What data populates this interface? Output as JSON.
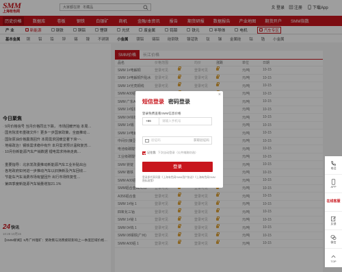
{
  "header": {
    "logo_main": "SMM",
    "logo_sub": "上海有色网",
    "search_placeholder": "大家都在搜   冬藏品",
    "login": "登录",
    "register": "注册",
    "download_app": "下载App"
  },
  "nav": [
    "历史价格",
    "数据库",
    "卷板",
    "钢铁",
    "白银矿",
    "商机",
    "金融/本资讯",
    "报告",
    "期货研报",
    "数据报告",
    "产业地图",
    "期货开户",
    "SMM指数"
  ],
  "nav_active_index": 0,
  "subnav": {
    "lead": "产  业",
    "items": [
      {
        "label": "新能源",
        "red": true
      },
      {
        "label": "钢铁",
        "red": false
      },
      {
        "label": "铜铝",
        "red": false
      },
      {
        "label": "锂镁",
        "red": false
      },
      {
        "label": "光伏",
        "red": false
      },
      {
        "label": "废金属",
        "red": false
      },
      {
        "label": "钨钼",
        "red": false
      },
      {
        "label": "铁元",
        "red": false
      },
      {
        "label": "半导体",
        "red": false
      },
      {
        "label": "电机",
        "red": false
      },
      {
        "label": "汽车专区",
        "red": true
      }
    ]
  },
  "subnav2": {
    "lead": "基本金属",
    "items": [
      "铜",
      "铝",
      "铅",
      "锌",
      "锡",
      "镍",
      "不锈钢",
      "小金属",
      "镁铝",
      "锡铝",
      "硅钢铁",
      "镍锰铁",
      "钛",
      "锑",
      "金属硅",
      "钴",
      "锆",
      "小金属"
    ]
  },
  "left": {
    "news_title": "今日聚焦",
    "news": [
      "9月价格信号 当月价格同比下跌， 市场回暖开始 本周…",
      "国务院发布重磅文件！更多一步国家政策，全面推动…",
      "国际原油价格震荡回升 本周需求回暖显著下滑~~.",
      "地缘政治！钢铁需求稳中有升 本月需求预计温和复苏…",
      "10月份新能源汽车产销数据 锂电需求持续走高…",
      "",
      "重要指导：北京发改委推动新能源汽车工业补贴出台",
      "各地政府如何进一步推动汽车以旧换新及汽车回收…",
      "节能车汽车消费市场有望回升 出行市场恢复性…",
      "第四季度新能源汽车销量增加21.1%"
    ],
    "news24_title": "24",
    "news24_title_suffix": "快讯",
    "news24_time": "10:28  10月15",
    "news24_line": "【SMM新闻】9月广州锂矿：受政策与消费疲软影响上一季度区域价格…"
  },
  "prices": {
    "tabs": [
      "SMM价格",
      "长江价格"
    ],
    "active_tab": 0,
    "columns": [
      "品名",
      "价格范围",
      "均价",
      "涨跌",
      "",
      "单位",
      "日期"
    ],
    "rows": [
      {
        "name": "SMM 1#电解铜",
        "v1": "登录可见",
        "v3": "登录可见",
        "unit": "元/吨",
        "date": "10-15"
      },
      {
        "name": "SMM 1#电解铜升贴水",
        "v1": "登录可见",
        "v3": "登录可见",
        "unit": "元/吨",
        "date": "10-15"
      },
      {
        "name": "SMM 1#光亮铜线",
        "v1": "登录可见",
        "v3": "登录可见",
        "unit": "元/吨",
        "date": "10-15"
      },
      {
        "name": "SMM A00铝",
        "v1": "登录可见",
        "v3": "登录可见",
        "unit": "元/吨",
        "date": "10-15"
      },
      {
        "name": "SMM 广东A00铝",
        "v1": "登录可见",
        "v3": "登录可见",
        "unit": "元/吨",
        "date": "10-15"
      },
      {
        "name": "SMM 1#铅锭",
        "v1": "登录可见",
        "v3": "登录可见",
        "unit": "元/吨",
        "date": "10-15"
      },
      {
        "name": "SMM 0#锌锭",
        "v1": "登录可见",
        "v3": "登录可见",
        "unit": "元/吨",
        "date": "10-15"
      },
      {
        "name": "SMM 1#锡",
        "v1": "登录可见",
        "v3": "登录可见",
        "unit": "元/吨",
        "date": "10-15"
      },
      {
        "name": "SMM 1#电解镍",
        "v1": "登录可见",
        "v3": "登录可见",
        "unit": "元/吨",
        "date": "10-15"
      },
      {
        "name": "中间价(镍豆)",
        "v1": "登录可见",
        "v3": "登录可见",
        "unit": "元/吨",
        "date": "10-15"
      },
      {
        "name": "电池级碳酸锂",
        "v1": "登录可见",
        "v3": "登录可见",
        "unit": "元/吨",
        "date": "10-15"
      },
      {
        "name": "工业级碳酸锂",
        "v1": "登录可见",
        "v3": "登录可见",
        "unit": "元/吨",
        "date": "10-15"
      },
      {
        "name": "SMM 镁锭",
        "v1": "登录可见",
        "v3": "登录可见",
        "unit": "元/吨",
        "date": "10-15"
      },
      {
        "name": "SMM 铬铁",
        "v1": "登录可见",
        "v3": "登录可见",
        "unit": "元/吨",
        "date": "10-15"
      },
      {
        "name": "SMM A00铝(铝锭)1",
        "v1": "登录可见",
        "v3": "登录可见",
        "unit": "元/吨",
        "date": "10-15"
      },
      {
        "name": "SMM铝合金ADC12",
        "v1": "登录可见",
        "v3": "登录可见",
        "unit": "元/吨",
        "date": "10-15"
      },
      {
        "name": "A356铝合金",
        "v1": "登录可见",
        "v3": "登录可见",
        "unit": "元/吨",
        "date": "10-15"
      },
      {
        "name": "SMM 1#钴 1",
        "v1": "登录可见",
        "v3": "登录可见",
        "unit": "元/吨",
        "date": "10-15"
      },
      {
        "name": "四氧化三钴",
        "v1": "登录可见",
        "v3": "登录可见",
        "unit": "元/吨",
        "date": "10-15"
      },
      {
        "name": "SMM 1#铋 1",
        "v1": "登录可见",
        "v3": "登录可见",
        "unit": "元/吨",
        "date": "10-15"
      },
      {
        "name": "SMM 0#钨 1",
        "v1": "登录可见",
        "v3": "登录可见",
        "unit": "元/吨",
        "date": "10-15"
      },
      {
        "name": "SMM 08钼铁(广州)",
        "v1": "登录可见",
        "v3": "登录可见",
        "unit": "元/吨",
        "date": "10-15"
      },
      {
        "name": "SMM A00铝 1",
        "v1": "登录可见",
        "v3": "登录可见",
        "unit": "元/吨",
        "date": "10-15"
      }
    ]
  },
  "modal": {
    "tab_sms": "短信登录",
    "tab_pwd": "密码登录",
    "close": "×",
    "subtitle": "登录免费查看SMM信息价格",
    "country_code": "+86",
    "phone_placeholder": "请输入手机号",
    "code_placeholder": "验证码",
    "get_code": "获取验证码",
    "agree_prefix": "记住我",
    "agree_text": "下次自动登录（公共电脑勿选）",
    "login_button": "登录",
    "terms": "登录即代表同意《上海有色网SMM用户协议》《上海有色网SMM隐私政策》"
  },
  "toolbar": [
    {
      "icon": "phone-icon",
      "label": "电话"
    },
    {
      "icon": "app-icon",
      "label": "APP"
    },
    {
      "icon": "",
      "label": "在线客服",
      "red": true
    },
    {
      "icon": "edit-icon",
      "label": "反馈"
    },
    {
      "icon": "wechat-icon",
      "label": "微信"
    },
    {
      "icon": "top-icon",
      "label": "TOP"
    }
  ],
  "colors": {
    "brand": "#c8161d",
    "overlay": "rgba(0,0,0,0.38)",
    "lock": "#e0a53a"
  }
}
